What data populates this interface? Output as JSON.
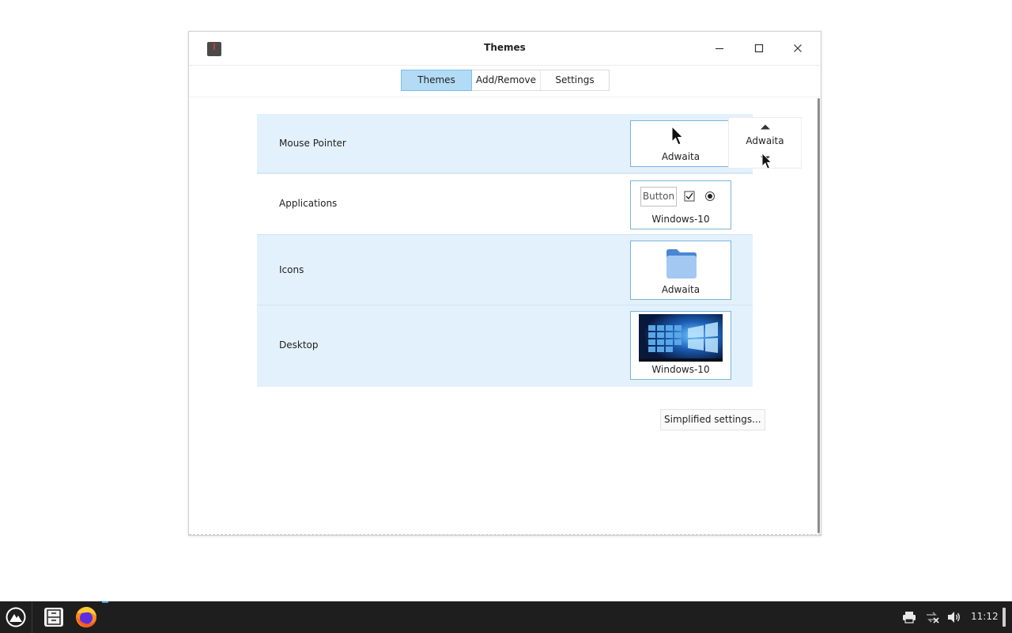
{
  "window": {
    "title": "Themes"
  },
  "tabs": [
    {
      "label": "Themes",
      "active": true
    },
    {
      "label": "Add/Remove",
      "active": false
    },
    {
      "label": "Settings",
      "active": false
    }
  ],
  "rows": [
    {
      "label": "Mouse Pointer",
      "theme": "Adwaita",
      "preview": "cursor-icon"
    },
    {
      "label": "Applications",
      "theme": "Windows-10",
      "preview": "widgets"
    },
    {
      "label": "Icons",
      "theme": "Adwaita",
      "preview": "folder-icon"
    },
    {
      "label": "Desktop",
      "theme": "Windows-10",
      "preview": "desktop-thumbnail"
    }
  ],
  "widgets_preview": {
    "button_label": "Button"
  },
  "spinner": {
    "value": "Adwaita"
  },
  "simplified_button": "Simplified settings...",
  "taskbar": {
    "clock": "11:12"
  },
  "colors": {
    "row_highlight": "#e3f1fc",
    "tab_active": "#b3dbf6",
    "preview_border": "#7ab5dc",
    "taskbar": "#1e1e1e"
  }
}
